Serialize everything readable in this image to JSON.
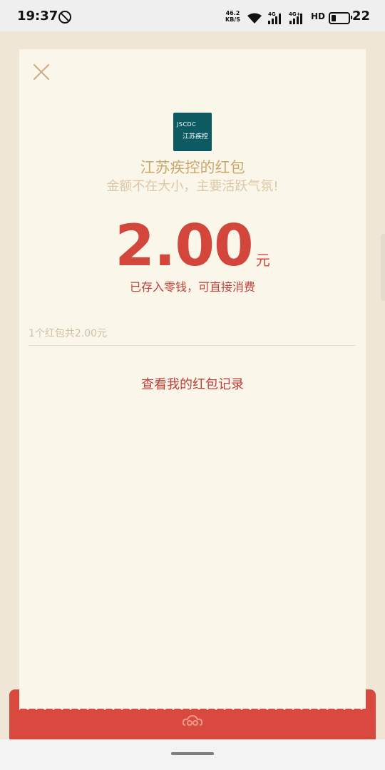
{
  "status_bar": {
    "time": "19:37",
    "network_speed_value": "46.2",
    "network_speed_unit": "KB/S",
    "sim1": "4G",
    "sim2": "4G+",
    "hd": "HD",
    "battery": "22"
  },
  "red_packet": {
    "logo_line1": "JSCDC",
    "logo_line2": "江苏疾控",
    "sender": "江苏疾控的红包",
    "wish": "金额不在大小，主要活跃气氛!",
    "amount": "2.00",
    "unit": "元",
    "saved_note": "已存入零钱，可直接消费",
    "summary": "1个红包共2.00元",
    "view_records": "查看我的红包记录"
  },
  "colors": {
    "accent_red": "#d2463b",
    "gold": "#c9a86e",
    "card_bg": "#fbf6ea",
    "page_bg": "#efe6d5"
  }
}
